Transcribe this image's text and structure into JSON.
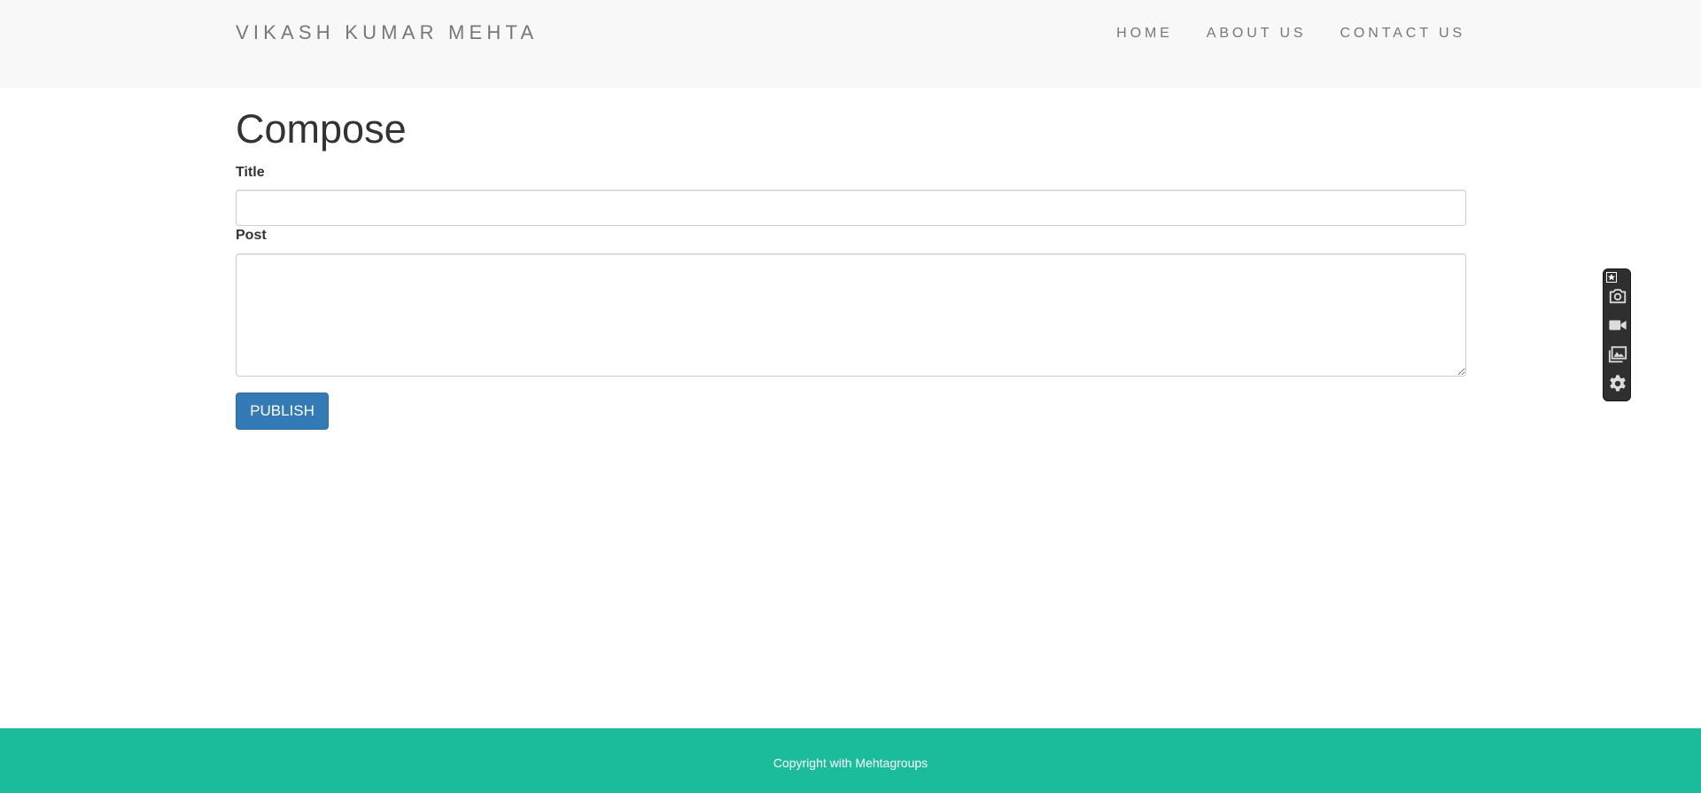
{
  "header": {
    "brand": "VIKASH KUMAR MEHTA",
    "nav": {
      "home": "HOME",
      "about": "ABOUT US",
      "contact": "CONTACT US"
    }
  },
  "compose": {
    "heading": "Compose",
    "title_label": "Title",
    "title_value": "",
    "post_label": "Post",
    "post_value": "",
    "publish_label": "PUBLISH"
  },
  "footer": {
    "text": "Copyright with Mehtagroups"
  },
  "capture_toolbar": {
    "icons": [
      "pin-icon",
      "camera-icon",
      "video-icon",
      "image-icon",
      "gear-icon"
    ]
  },
  "colors": {
    "navbar_bg": "#f8f8f8",
    "nav_text": "#777777",
    "primary_button": "#337ab7",
    "footer_bg": "#1abc9c",
    "toolbar_bg": "#2f2f2f"
  }
}
